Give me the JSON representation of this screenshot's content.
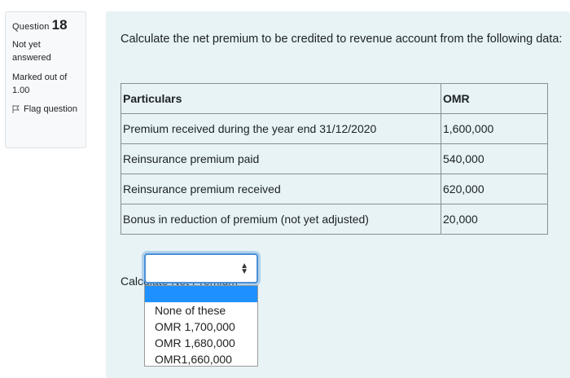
{
  "question_info": {
    "question_word": "Question",
    "question_number": "18",
    "state": "Not yet answered",
    "grade": "Marked out of 1.00",
    "flag_label": "Flag question",
    "flag_icon": "flag-icon"
  },
  "question": {
    "text": "Calculate the net premium to be credited to revenue account from the following data:",
    "table": {
      "headers": [
        "Particulars",
        "OMR"
      ],
      "rows": [
        [
          "Premium received during the year end 31/12/2020",
          "1,600,000"
        ],
        [
          "Reinsurance premium paid",
          "540,000"
        ],
        [
          "Reinsurance premium received",
          "620,000"
        ],
        [
          "Bonus in reduction of premium (not yet adjusted)",
          "20,000"
        ]
      ]
    }
  },
  "answer": {
    "label": "Calculate Net Premium",
    "selected_value": "",
    "caret_icon": "updown-caret-icon",
    "options": [
      "",
      "None of these",
      "OMR 1,700,000",
      "OMR 1,680,000",
      "OMR1,660,000"
    ]
  },
  "colors": {
    "content_bg": "#e7f3f5",
    "focus_ring": "#4a8fd6",
    "option_highlight": "#1e90ff"
  }
}
